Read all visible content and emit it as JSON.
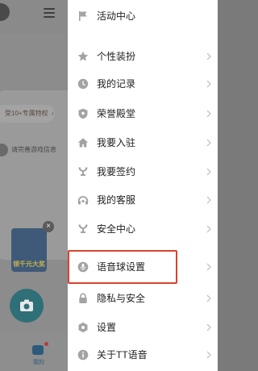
{
  "background": {
    "promo_pill": "受10+专属特权",
    "profile_hint": "请完善游戏信息",
    "ad_text": "领千元大奖",
    "ad_close": "×",
    "tab_label": "我的"
  },
  "drawer": {
    "items": [
      {
        "label": "活动中心",
        "icon": "flag-icon"
      },
      {
        "label": "个性装扮",
        "icon": "star-icon"
      },
      {
        "label": "我的记录",
        "icon": "clock-icon"
      },
      {
        "label": "荣誉殿堂",
        "icon": "shield-icon"
      },
      {
        "label": "我要入驻",
        "icon": "home-icon"
      },
      {
        "label": "我要签约",
        "icon": "cup-icon"
      },
      {
        "label": "我的客服",
        "icon": "headset-icon"
      },
      {
        "label": "安全中心",
        "icon": "trophy-icon"
      },
      {
        "label": "语音球设置",
        "icon": "mic-icon"
      },
      {
        "label": "隐私与安全",
        "icon": "lock-icon"
      },
      {
        "label": "设置",
        "icon": "gear-icon"
      },
      {
        "label": "关于TT语音",
        "icon": "info-icon"
      }
    ]
  },
  "colors": {
    "icon": "#a3a3a3",
    "highlight": "#d9432c",
    "overlay": "#8c8c8c"
  }
}
